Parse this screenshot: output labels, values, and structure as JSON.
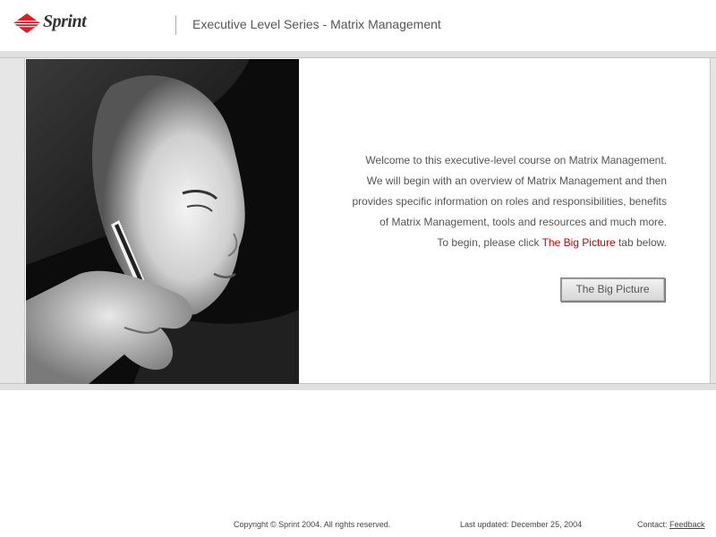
{
  "header": {
    "logo_text": "Sprint",
    "title": "Executive Level Series - Matrix Management"
  },
  "main": {
    "intro_lines": [
      "Welcome to this executive-level course on Matrix Management.",
      "We will begin with an overview of Matrix Management and then",
      "provides specific information on roles and responsibilities, benefits",
      "of Matrix Management, tools and resources and much more."
    ],
    "begin_prefix": "To begin, please click ",
    "begin_highlight": "The Big Picture",
    "begin_suffix": " tab below.",
    "button_label": "The Big Picture",
    "highlight_color": "#cc0000"
  },
  "footer": {
    "copyright": "Copyright © Sprint 2004. All rights reserved.",
    "last_updated": "Last  updated: December 25, 2004",
    "contact_label": "Contact: ",
    "contact_link": "Feedback"
  },
  "icons": {
    "logo": "sprint-diamond-icon"
  }
}
